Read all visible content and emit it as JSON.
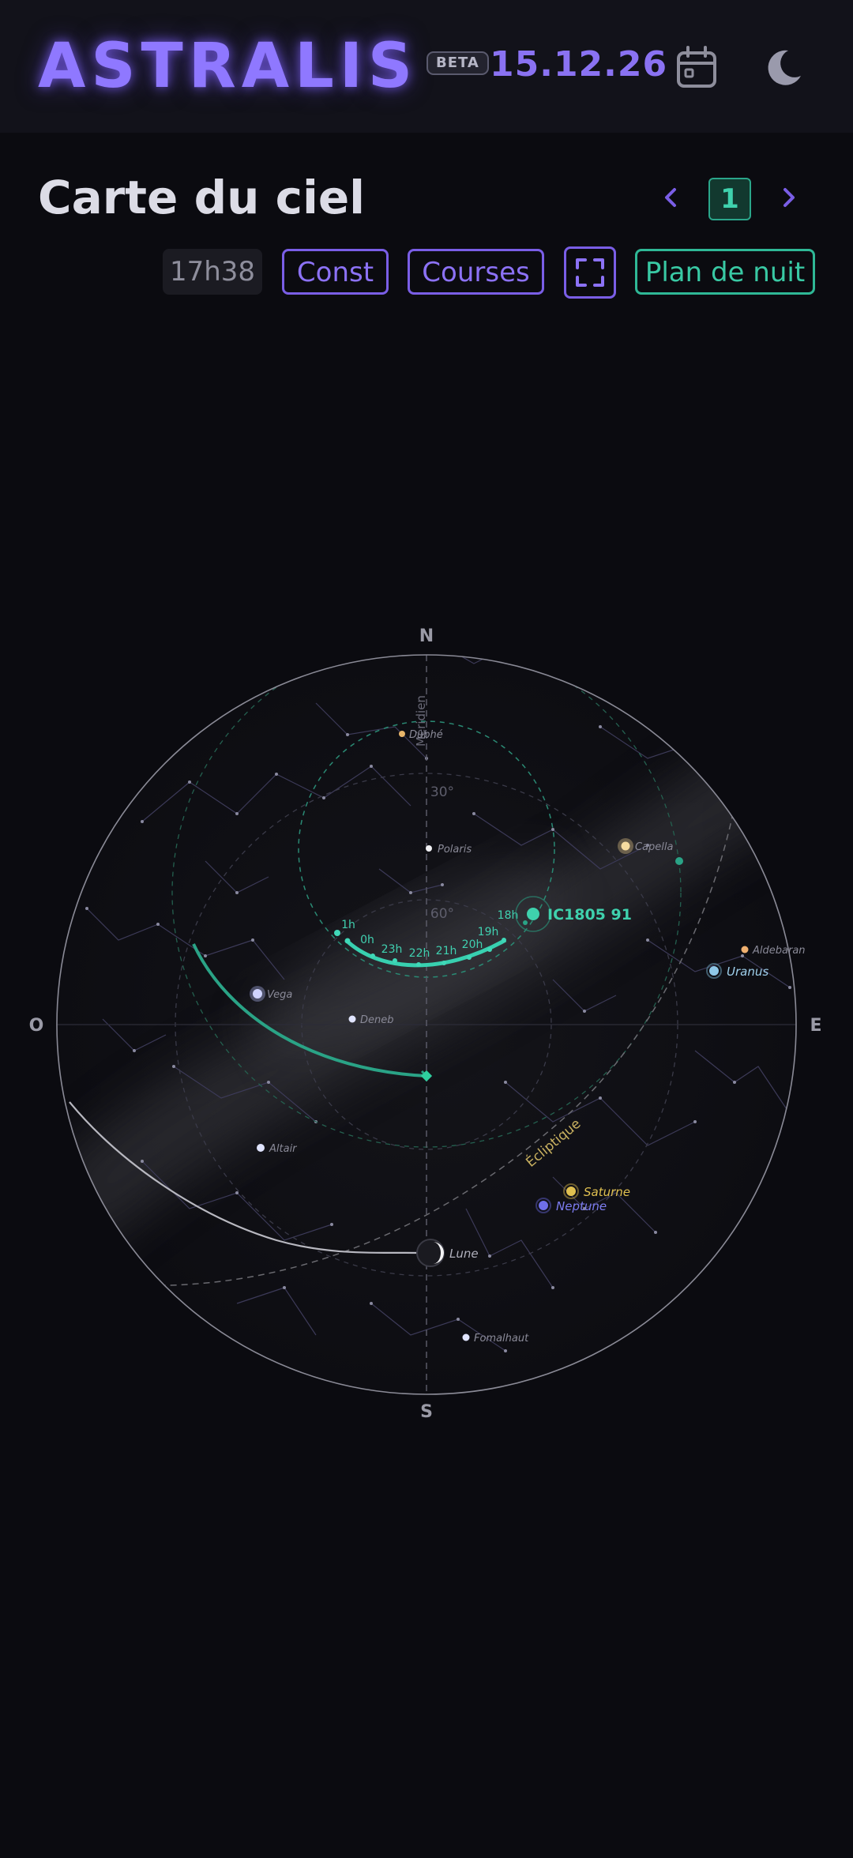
{
  "header": {
    "logo": "ASTRALIS",
    "badge": "BETA",
    "date": "15.12.26",
    "calendar_icon": "calendar-icon",
    "theme_icon": "moon-icon"
  },
  "page": {
    "title": "Carte du ciel",
    "page_number": "1"
  },
  "toolbar": {
    "time": "17h38",
    "const_label": "Const",
    "courses_label": "Courses",
    "fullscreen_icon": "fullscreen-icon",
    "plan_label": "Plan de nuit"
  },
  "sky": {
    "cardinals": {
      "north": "N",
      "south": "S",
      "east": "E",
      "west": "O"
    },
    "meridian_label": "Méridien",
    "ecliptic_label": "Écliptique",
    "alt_30": "30°",
    "alt_60": "60°",
    "stars": {
      "dubhe": "Dubhé",
      "polaris": "Polaris",
      "capella": "Capella",
      "aldebaran": "Aldebaran",
      "vega": "Vega",
      "deneb": "Deneb",
      "altair": "Altair",
      "fomalhaut": "Fomalhaut"
    },
    "planets": {
      "uranus": "Uranus",
      "saturne": "Saturne",
      "neptune": "Neptune",
      "lune": "Lune"
    },
    "target": "IC1805 91",
    "hours": [
      "18h",
      "19h",
      "20h",
      "21h",
      "22h",
      "23h",
      "0h",
      "1h"
    ],
    "colors": {
      "accent_violet": "#8c72f6",
      "accent_teal": "#2fb896",
      "saturn": "#e0c050",
      "neptune": "#6f6fe8",
      "uranus": "#8fc8e8"
    }
  }
}
